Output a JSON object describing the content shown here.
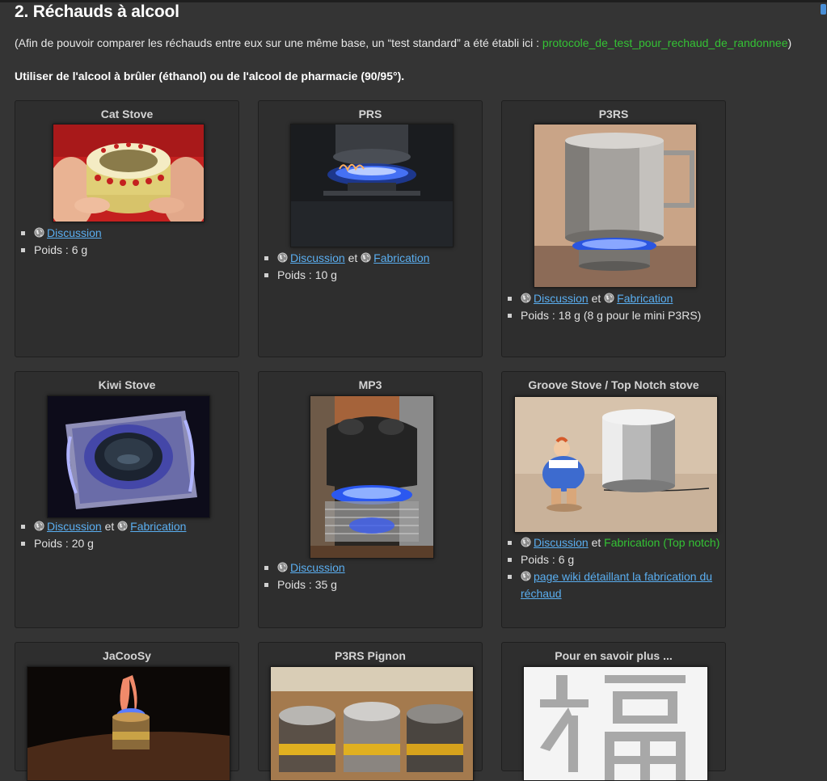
{
  "section": {
    "title": "2. Réchauds à alcool",
    "intro_prefix": "(Afin de pouvoir comparer les réchauds entre eux sur une même base, un “test standard” a été établi ici : ",
    "intro_link": "protocole_de_test_pour_rechaud_de_randonnee",
    "intro_suffix": ")",
    "fuel_note": "Utiliser de l'alcool à brûler (éthanol) ou de l'alcool de pharmacie (90/95°)."
  },
  "colors": {
    "background": "#343434",
    "card_background": "#2e2e2e",
    "link_blue": "#5aaef0",
    "link_green": "#34c234"
  },
  "icons": {
    "globe": "globe-icon",
    "bullet": "square-bullet"
  },
  "words": {
    "and": "et",
    "discussion": "Discussion",
    "fabrication": "Fabrication"
  },
  "cards": [
    {
      "title": "Cat Stove",
      "weight": "Poids : 6 g"
    },
    {
      "title": "PRS",
      "weight": "Poids : 10 g"
    },
    {
      "title": "P3RS",
      "weight": "Poids : 18 g (8 g pour le mini P3RS)"
    },
    {
      "title": "Kiwi Stove",
      "weight": "Poids : 20 g"
    },
    {
      "title": "MP3",
      "weight": "Poids : 35 g"
    },
    {
      "title": "Groove Stove / Top Notch stove",
      "fabrication_plain": "Fabrication (Top notch)",
      "weight": "Poids : 6 g",
      "wiki_link": "page wiki détaillant la fabrication du réchaud"
    },
    {
      "title": "JaCooSy"
    },
    {
      "title": "P3RS Pignon"
    },
    {
      "title": "Pour en savoir plus ..."
    }
  ]
}
